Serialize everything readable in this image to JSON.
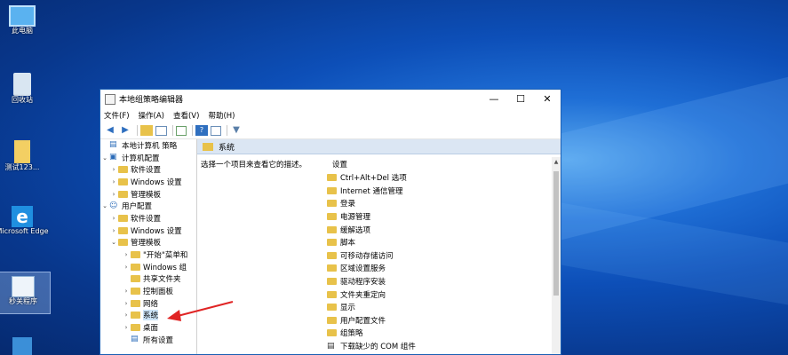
{
  "desktop": {
    "icons": [
      {
        "label": "此电脑"
      },
      {
        "label": "回收站"
      },
      {
        "label": "测试123..."
      },
      {
        "label": "Microsoft Edge"
      },
      {
        "label": "秒关程序"
      }
    ]
  },
  "window": {
    "title": "本地组策略编辑器",
    "controls": {
      "minimize": "—",
      "maximize": "☐",
      "close": "✕"
    },
    "menu": [
      "文件(F)",
      "操作(A)",
      "查看(V)",
      "帮助(H)"
    ]
  },
  "tree": {
    "root": "本地计算机 策略",
    "computer_config": "计算机配置",
    "cc_items": [
      "软件设置",
      "Windows 设置",
      "管理模板"
    ],
    "user_config": "用户配置",
    "uc_items": [
      "软件设置",
      "Windows 设置",
      "管理模板"
    ],
    "admin_templates_children": [
      "\"开始\"菜单和",
      "Windows 组",
      "共享文件夹",
      "控制面板",
      "网络",
      "系统",
      "桌面",
      "所有设置"
    ]
  },
  "right_pane": {
    "header": "系统",
    "description": "选择一个项目来查看它的描述。",
    "column": "设置",
    "items": [
      "Ctrl+Alt+Del 选项",
      "Internet 通信管理",
      "登录",
      "电源管理",
      "缓解选项",
      "脚本",
      "可移动存储访问",
      "区域设置服务",
      "驱动程序安装",
      "文件夹重定向",
      "显示",
      "用户配置文件",
      "组策略",
      "下载缺少的 COM 组件"
    ]
  },
  "colors": {
    "accent": "#1a5fb4",
    "folder": "#e8c24a",
    "arrow": "#e02424"
  }
}
